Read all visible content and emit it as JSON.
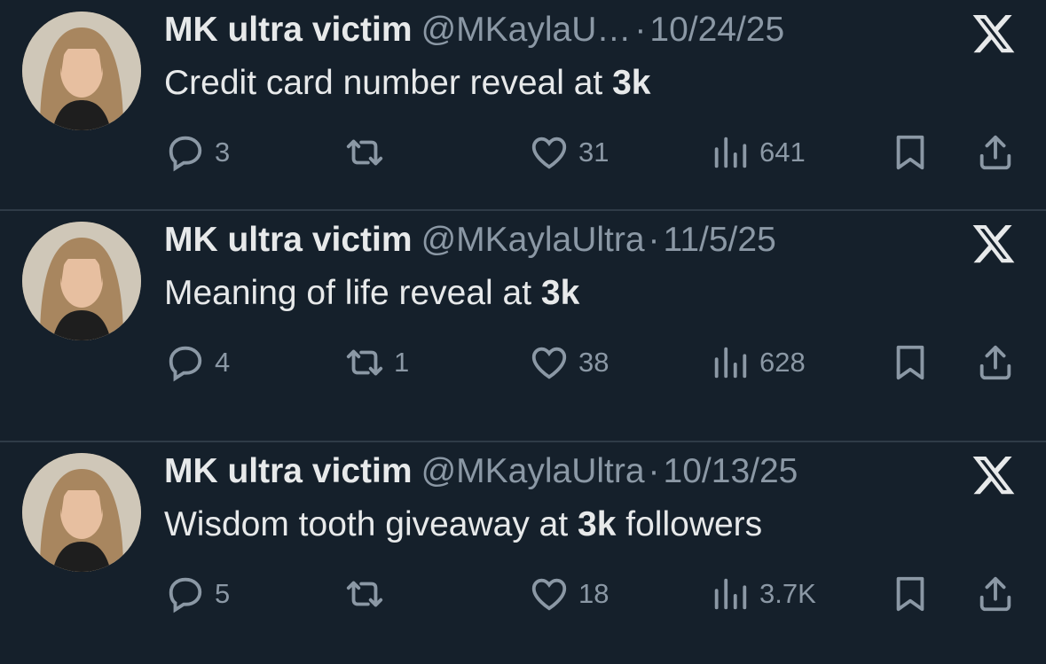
{
  "tweets": [
    {
      "name": "MK ultra victim",
      "handle": "@MKaylaU…",
      "date": "10/24/25",
      "text_before": "Credit card number reveal at ",
      "text_bold": "3k",
      "text_after": "",
      "replies": "3",
      "retweets": "",
      "likes": "31",
      "views": "641"
    },
    {
      "name": "MK ultra victim",
      "handle": "@MKaylaUltra",
      "date": "11/5/25",
      "text_before": "Meaning of life reveal at ",
      "text_bold": "3k",
      "text_after": "",
      "replies": "4",
      "retweets": "1",
      "likes": "38",
      "views": "628"
    },
    {
      "name": "MK ultra victim",
      "handle": "@MKaylaUltra",
      "date": "10/13/25",
      "text_before": "Wisdom tooth giveaway at ",
      "text_bold": "3k",
      "text_after": " followers",
      "replies": "5",
      "retweets": "",
      "likes": "18",
      "views": "3.7K"
    }
  ],
  "separator": "·",
  "icons": {
    "reply": "reply-icon",
    "retweet": "retweet-icon",
    "like": "heart-icon",
    "views": "views-icon",
    "bookmark": "bookmark-icon",
    "share": "share-icon",
    "logo": "x-logo-icon"
  },
  "colors": {
    "background": "#15202b",
    "text": "#e7e9ea",
    "secondary": "#8b98a5",
    "divider": "#2f3b47"
  }
}
